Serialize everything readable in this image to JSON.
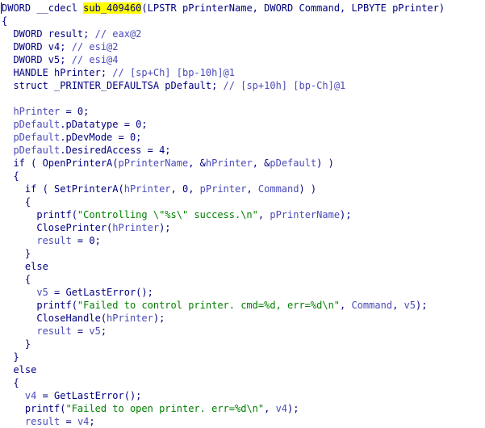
{
  "code": {
    "lines": [
      [
        [
          "plain",
          "DWORD __cdecl "
        ],
        [
          "hl",
          "sub_409460"
        ],
        [
          "plain",
          "(LPSTR pPrinterName, DWORD Command, LPBYTE pPrinter)"
        ]
      ],
      [
        [
          "plain",
          "{"
        ]
      ],
      [
        [
          "plain",
          "  DWORD result; "
        ],
        [
          "cmt",
          "// eax@2"
        ]
      ],
      [
        [
          "plain",
          "  DWORD v4; "
        ],
        [
          "cmt",
          "// esi@2"
        ]
      ],
      [
        [
          "plain",
          "  DWORD v5; "
        ],
        [
          "cmt",
          "// esi@4"
        ]
      ],
      [
        [
          "plain",
          "  HANDLE hPrinter; "
        ],
        [
          "cmt",
          "// [sp+Ch] [bp-10h]@1"
        ]
      ],
      [
        [
          "plain",
          "  struct _PRINTER_DEFAULTSA pDefault; "
        ],
        [
          "cmt",
          "// [sp+10h] [bp-Ch]@1"
        ]
      ],
      [
        [
          "plain",
          ""
        ]
      ],
      [
        [
          "var",
          "  hPrinter"
        ],
        [
          "plain",
          " = 0;"
        ]
      ],
      [
        [
          "var",
          "  pDefault"
        ],
        [
          "plain",
          ".pDatatype = 0;"
        ]
      ],
      [
        [
          "var",
          "  pDefault"
        ],
        [
          "plain",
          ".pDevMode = 0;"
        ]
      ],
      [
        [
          "var",
          "  pDefault"
        ],
        [
          "plain",
          ".DesiredAccess = 4;"
        ]
      ],
      [
        [
          "plain",
          "  if ( OpenPrinterA("
        ],
        [
          "var",
          "pPrinterName"
        ],
        [
          "plain",
          ", &"
        ],
        [
          "var",
          "hPrinter"
        ],
        [
          "plain",
          ", &"
        ],
        [
          "var",
          "pDefault"
        ],
        [
          "plain",
          ") )"
        ]
      ],
      [
        [
          "plain",
          "  {"
        ]
      ],
      [
        [
          "plain",
          "    if ( SetPrinterA("
        ],
        [
          "var",
          "hPrinter"
        ],
        [
          "plain",
          ", 0, "
        ],
        [
          "var",
          "pPrinter"
        ],
        [
          "plain",
          ", "
        ],
        [
          "var",
          "Command"
        ],
        [
          "plain",
          ") )"
        ]
      ],
      [
        [
          "plain",
          "    {"
        ]
      ],
      [
        [
          "plain",
          "      printf("
        ],
        [
          "str",
          "\"Controlling \\\"%s\\\" success.\\n\""
        ],
        [
          "plain",
          ", "
        ],
        [
          "var",
          "pPrinterName"
        ],
        [
          "plain",
          ");"
        ]
      ],
      [
        [
          "plain",
          "      ClosePrinter("
        ],
        [
          "var",
          "hPrinter"
        ],
        [
          "plain",
          ");"
        ]
      ],
      [
        [
          "var",
          "      result"
        ],
        [
          "plain",
          " = 0;"
        ]
      ],
      [
        [
          "plain",
          "    }"
        ]
      ],
      [
        [
          "plain",
          "    else"
        ]
      ],
      [
        [
          "plain",
          "    {"
        ]
      ],
      [
        [
          "var",
          "      v5"
        ],
        [
          "plain",
          " = GetLastError();"
        ]
      ],
      [
        [
          "plain",
          "      printf("
        ],
        [
          "str",
          "\"Failed to control printer. cmd=%d, err=%d\\n\""
        ],
        [
          "plain",
          ", "
        ],
        [
          "var",
          "Command"
        ],
        [
          "plain",
          ", "
        ],
        [
          "var",
          "v5"
        ],
        [
          "plain",
          ");"
        ]
      ],
      [
        [
          "plain",
          "      CloseHandle("
        ],
        [
          "var",
          "hPrinter"
        ],
        [
          "plain",
          ");"
        ]
      ],
      [
        [
          "var",
          "      result"
        ],
        [
          "plain",
          " = "
        ],
        [
          "var",
          "v5"
        ],
        [
          "plain",
          ";"
        ]
      ],
      [
        [
          "plain",
          "    }"
        ]
      ],
      [
        [
          "plain",
          "  }"
        ]
      ],
      [
        [
          "plain",
          "  else"
        ]
      ],
      [
        [
          "plain",
          "  {"
        ]
      ],
      [
        [
          "var",
          "    v4"
        ],
        [
          "plain",
          " = GetLastError();"
        ]
      ],
      [
        [
          "plain",
          "    printf("
        ],
        [
          "str",
          "\"Failed to open printer. err=%d\\n\""
        ],
        [
          "plain",
          ", "
        ],
        [
          "var",
          "v4"
        ],
        [
          "plain",
          ");"
        ]
      ],
      [
        [
          "var",
          "    result"
        ],
        [
          "plain",
          " = "
        ],
        [
          "var",
          "v4"
        ],
        [
          "plain",
          ";"
        ]
      ]
    ]
  }
}
